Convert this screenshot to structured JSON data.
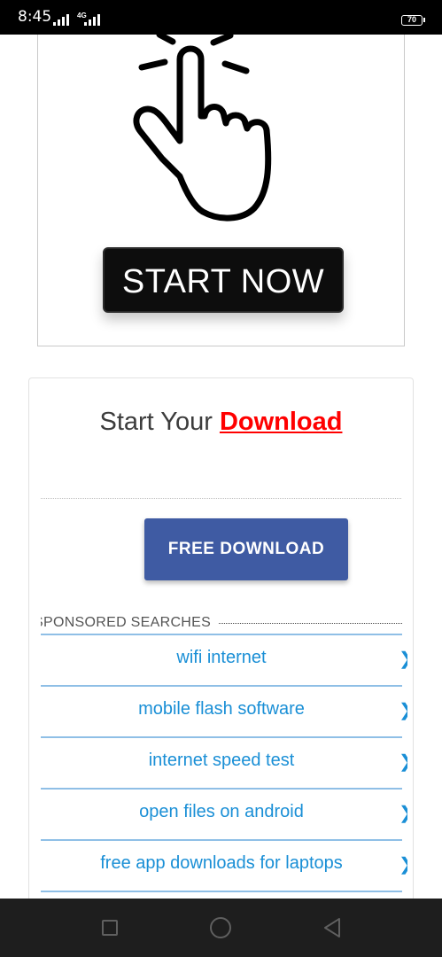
{
  "status_bar": {
    "time": "8:45",
    "network_tag": "4G",
    "battery": "70"
  },
  "ad": {
    "button_label": "START NOW",
    "icons": [
      "hand-pointer-icon"
    ]
  },
  "download_card": {
    "headline_prefix": "Start Your ",
    "headline_highlight": "Download",
    "button_label": "FREE DOWNLOAD",
    "sponsored_label": "SPONSORED SEARCHES",
    "searches": [
      "wifi internet",
      "mobile flash software",
      "internet speed test",
      "open files on android",
      "free app downloads for laptops"
    ],
    "colors": {
      "highlight": "#ff0000",
      "button": "#3f5ba3",
      "link": "#1a8fd6"
    }
  },
  "nav_bar": {
    "icons": [
      "recent-apps-icon",
      "home-icon",
      "back-icon"
    ]
  }
}
